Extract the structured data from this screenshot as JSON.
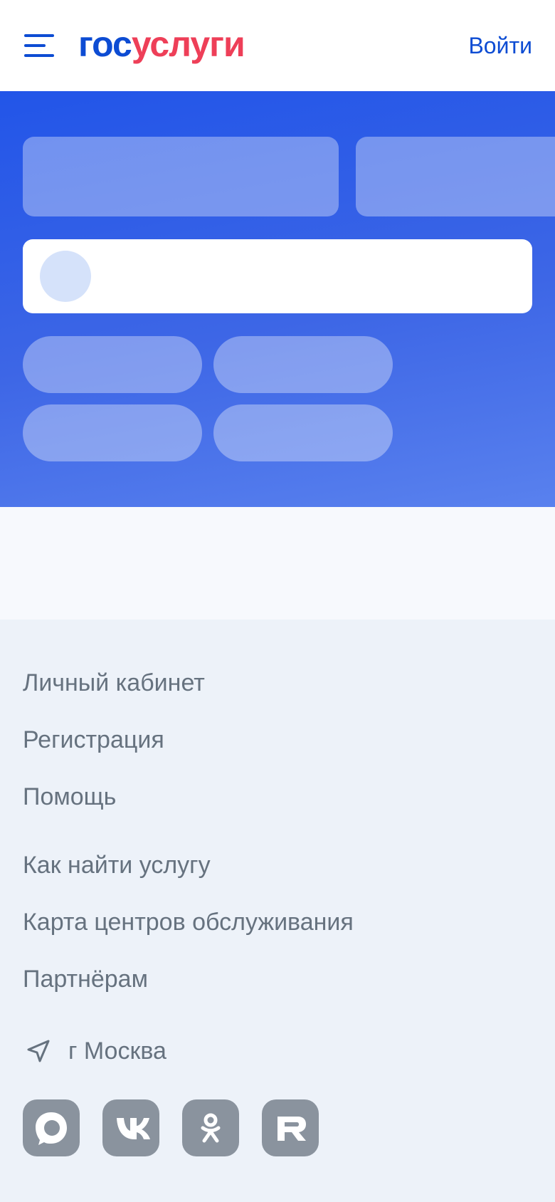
{
  "header": {
    "logo_part1": "гос",
    "logo_part2": "услуги",
    "login_label": "Войти"
  },
  "footer": {
    "links": [
      "Личный кабинет",
      "Регистрация",
      "Помощь",
      "Как найти услугу",
      "Карта центров обслуживания",
      "Партнёрам"
    ],
    "city": "г Москва",
    "socials": [
      "max-icon",
      "vk-icon",
      "ok-icon",
      "rutube-icon"
    ]
  },
  "colors": {
    "brand_blue": "#0d4cd3",
    "brand_red": "#ee3f58",
    "hero_blue": "#2255e8",
    "footer_bg": "#edf2f9",
    "footer_text": "#66727f",
    "social_bg": "#8a939e"
  }
}
